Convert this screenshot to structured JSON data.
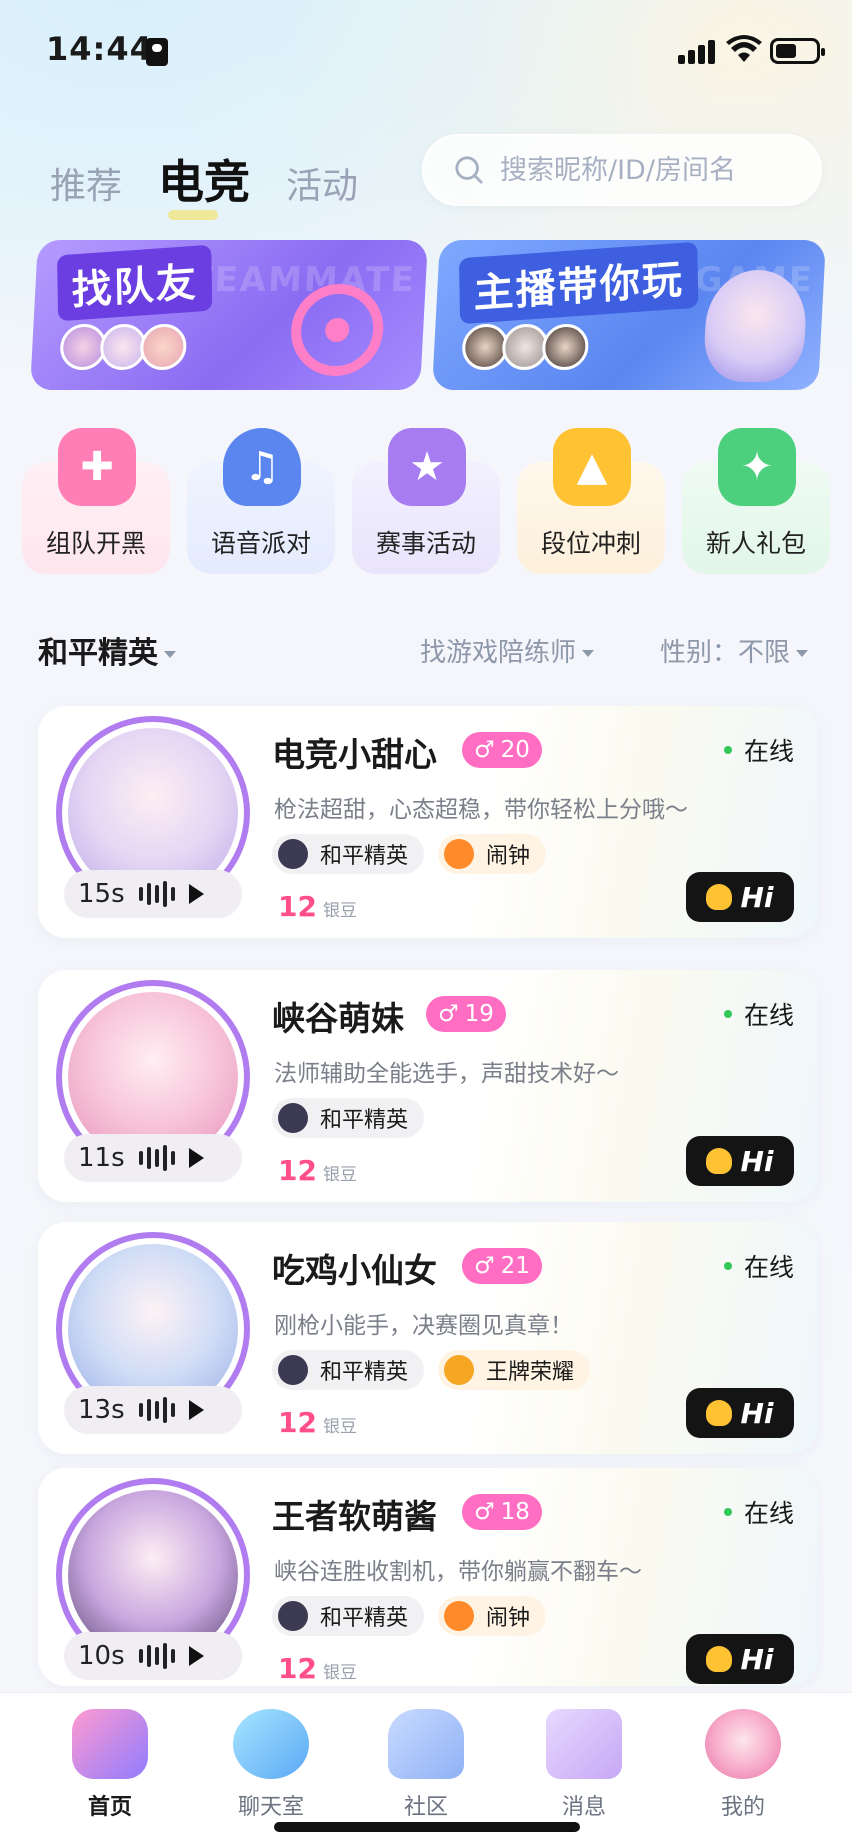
{
  "status_bar": {
    "time": "14:44"
  },
  "top_tabs": [
    {
      "label": "推荐",
      "active": false
    },
    {
      "label": "电竞",
      "active": true
    },
    {
      "label": "活动",
      "active": false
    }
  ],
  "search": {
    "placeholder": "搜索昵称/ID/房间名"
  },
  "banners": [
    {
      "title": "找队友",
      "watermark": "TEAMMATE"
    },
    {
      "title": "主播带你玩",
      "watermark": "GAME"
    }
  ],
  "categories": [
    {
      "label": "组队开黑",
      "icon": "gamepad-icon",
      "color": "#ff7eb6"
    },
    {
      "label": "语音派对",
      "icon": "headphones-icon",
      "color": "#5b86f0"
    },
    {
      "label": "赛事活动",
      "icon": "trophy-icon",
      "color": "#a67cf0"
    },
    {
      "label": "段位冲刺",
      "icon": "rocket-icon",
      "color": "#ffc233"
    },
    {
      "label": "新人礼包",
      "icon": "gift-icon",
      "color": "#4cd07d"
    }
  ],
  "filters": {
    "game": "和平精英",
    "coach": "找游戏陪练师",
    "gender": "性别：不限"
  },
  "users": [
    {
      "name": "电竞小甜心",
      "age": "20",
      "status": "在线",
      "bio": "枪法超甜，心态超稳，带你轻松上分哦～",
      "tags": [
        {
          "label": "和平精英",
          "icon": "helmet-icon"
        },
        {
          "label": "闹钟",
          "icon": "alarm-icon"
        }
      ],
      "price": "12",
      "unit": "银豆",
      "voice": "15s",
      "hi": "Hi"
    },
    {
      "name": "峡谷萌妹",
      "age": "19",
      "status": "在线",
      "bio": "法师辅助全能选手，声甜技术好～",
      "tags": [
        {
          "label": "和平精英",
          "icon": "helmet-icon"
        }
      ],
      "price": "12",
      "unit": "银豆",
      "voice": "11s",
      "hi": "Hi"
    },
    {
      "name": "吃鸡小仙女",
      "age": "21",
      "status": "在线",
      "bio": "刚枪小能手，决赛圈见真章！",
      "tags": [
        {
          "label": "和平精英",
          "icon": "helmet-icon"
        },
        {
          "label": "王牌荣耀",
          "icon": "medal-icon"
        }
      ],
      "price": "12",
      "unit": "银豆",
      "voice": "13s",
      "hi": "Hi"
    },
    {
      "name": "王者软萌酱",
      "age": "18",
      "status": "在线",
      "bio": "峡谷连胜收割机，带你躺赢不翻车～",
      "tags": [
        {
          "label": "和平精英",
          "icon": "helmet-icon"
        },
        {
          "label": "闹钟",
          "icon": "alarm-icon"
        }
      ],
      "price": "12",
      "unit": "银豆",
      "voice": "10s",
      "hi": "Hi"
    }
  ],
  "bottom_nav": [
    {
      "label": "首页",
      "icon": "gamepad-icon",
      "active": true
    },
    {
      "label": "聊天室",
      "icon": "chat-bubble-icon",
      "active": false
    },
    {
      "label": "社区",
      "icon": "community-icon",
      "active": false
    },
    {
      "label": "消息",
      "icon": "envelope-icon",
      "active": false
    },
    {
      "label": "我的",
      "icon": "profile-avatar-icon",
      "active": false
    }
  ],
  "colors": {
    "accent_pink": "#ff6ec2",
    "online_green": "#34c759",
    "ring_purple": "#b07cf0"
  }
}
